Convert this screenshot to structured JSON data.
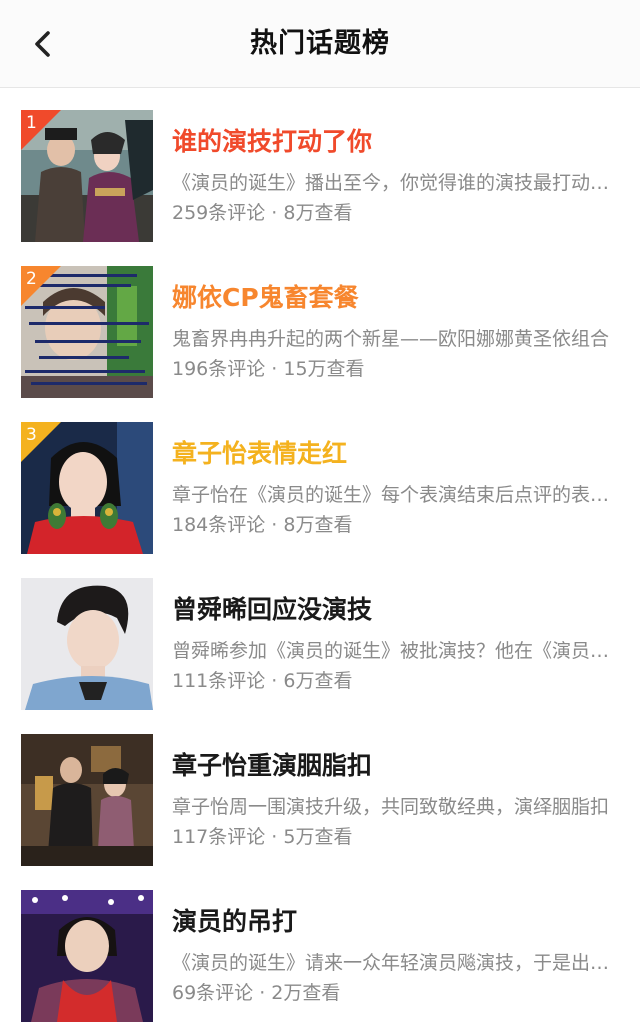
{
  "nav": {
    "title": "热门话题榜",
    "back_icon": "chevron-left-icon"
  },
  "colors": {
    "rank1": "#f04a2b",
    "rank2": "#f7862e",
    "rank3": "#f4b21f",
    "title_default": "#1a1a1a",
    "secondary_text": "#8a8a8a"
  },
  "topics": [
    {
      "rank": "1",
      "title": "谁的演技打动了你",
      "desc": "《演员的诞生》播出至今，你觉得谁的演技最打动你？",
      "meta": "259条评论 · 8万查看"
    },
    {
      "rank": "2",
      "title": "娜依CP鬼畜套餐",
      "desc": "鬼畜界冉冉升起的两个新星——欧阳娜娜黄圣依组合",
      "meta": "196条评论 · 15万查看"
    },
    {
      "rank": "3",
      "title": "章子怡表情走红",
      "desc": "章子怡在《演员的诞生》每个表演结束后点评的表情走红",
      "meta": "184条评论 · 8万查看"
    },
    {
      "rank": "",
      "title": "曾舜晞回应没演技",
      "desc": "曾舜晞参加《演员的诞生》被批演技？他在《演员的诞生》回应",
      "meta": "111条评论 · 6万查看"
    },
    {
      "rank": "",
      "title": "章子怡重演胭脂扣",
      "desc": "章子怡周一围演技升级，共同致敬经典，演绎胭脂扣",
      "meta": "117条评论 · 5万查看"
    },
    {
      "rank": "",
      "title": "演员的吊打",
      "desc": "《演员的诞生》请来一众年轻演员飚演技，于是出现了吊打",
      "meta": "69条评论 · 2万查看"
    }
  ]
}
